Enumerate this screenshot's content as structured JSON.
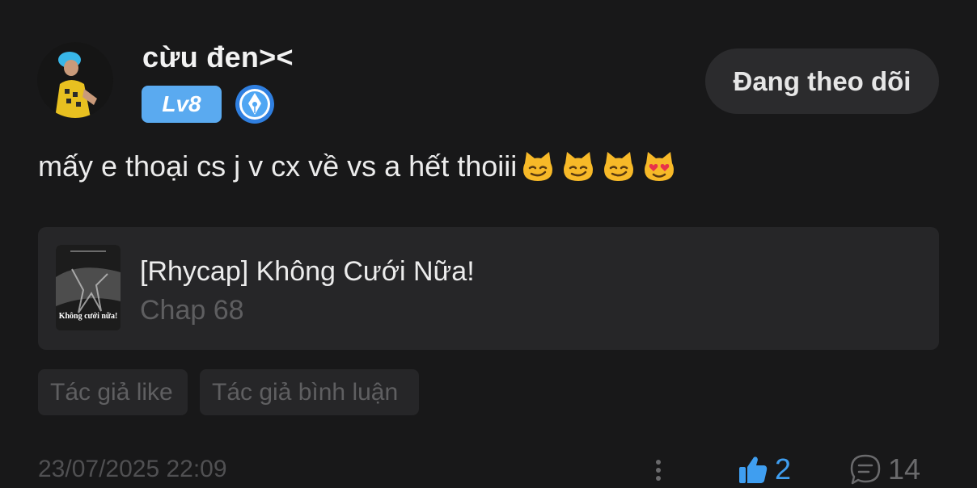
{
  "user": {
    "name": "cừu đen><",
    "level": "Lv8",
    "follow_label": "Đang theo dõi"
  },
  "comment": {
    "text": "mấy e thoại cs j v cx về vs a hết thoiii",
    "emojis": [
      "smirking-cat-icon",
      "smirking-cat-icon",
      "smirking-cat-icon",
      "heart-eyes-cat-icon"
    ]
  },
  "story": {
    "title": "[Rhycap] Không Cưới Nữa!",
    "chapter": "Chap 68",
    "cover_text": "Không cưới nữa!"
  },
  "tags": [
    "Tác giả like",
    "Tác giả bình luận"
  ],
  "footer": {
    "timestamp": "23/07/2025 22:09",
    "like_count": "2",
    "comment_count": "14"
  },
  "colors": {
    "background": "#181819",
    "card": "#262628",
    "level_badge": "#5aaaf0",
    "accent_blue": "#3f9ef0"
  }
}
